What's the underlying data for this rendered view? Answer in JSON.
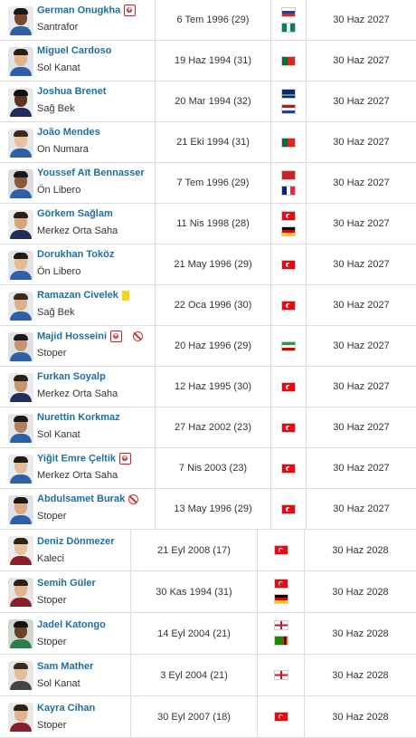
{
  "players": [
    {
      "name": "German Onugkha",
      "position": "Santrafor",
      "birth": "6 Tem 1996 (29)",
      "flags": [
        "russia",
        "nigeria"
      ],
      "contract": "30 Haz 2027",
      "badges": [
        "injury"
      ]
    },
    {
      "name": "Miguel Cardoso",
      "position": "Sol Kanat",
      "birth": "19 Haz 1994 (31)",
      "flags": [
        "portugal"
      ],
      "contract": "30 Haz 2027",
      "badges": []
    },
    {
      "name": "Joshua Brenet",
      "position": "Sağ Bek",
      "birth": "20 Mar 1994 (32)",
      "flags": [
        "curacao",
        "netherlands"
      ],
      "contract": "30 Haz 2027",
      "badges": []
    },
    {
      "name": "João Mendes",
      "position": "On Numara",
      "birth": "21 Eki 1994 (31)",
      "flags": [
        "portugal"
      ],
      "contract": "30 Haz 2027",
      "badges": []
    },
    {
      "name": "Youssef Aït Bennasser",
      "position": "Ön Libero",
      "birth": "7 Tem 1996 (29)",
      "flags": [
        "morocco",
        "france"
      ],
      "contract": "30 Haz 2027",
      "badges": []
    },
    {
      "name": "Görkem Sağlam",
      "position": "Merkez Orta Saha",
      "birth": "11 Nis 1998 (28)",
      "flags": [
        "turkey",
        "germany"
      ],
      "contract": "30 Haz 2027",
      "badges": []
    },
    {
      "name": "Dorukhan Toköz",
      "position": "Ön Libero",
      "birth": "21 May 1996 (29)",
      "flags": [
        "turkey"
      ],
      "contract": "30 Haz 2027",
      "badges": []
    },
    {
      "name": "Ramazan Civelek",
      "position": "Sağ Bek",
      "birth": "22 Oca 1996 (30)",
      "flags": [
        "turkey"
      ],
      "contract": "30 Haz 2027",
      "badges": [
        "yellow"
      ]
    },
    {
      "name": "Majid Hosseini",
      "position": "Stoper",
      "birth": "20 Haz 1996 (29)",
      "flags": [
        "iran"
      ],
      "contract": "30 Haz 2027",
      "badges": [
        "injury",
        "ban"
      ]
    },
    {
      "name": "Furkan Soyalp",
      "position": "Merkez Orta Saha",
      "birth": "12 Haz 1995 (30)",
      "flags": [
        "turkey"
      ],
      "contract": "30 Haz 2027",
      "badges": []
    },
    {
      "name": "Nurettin Korkmaz",
      "position": "Sol Kanat",
      "birth": "27 Haz 2002 (23)",
      "flags": [
        "turkey"
      ],
      "contract": "30 Haz 2027",
      "badges": []
    },
    {
      "name": "Yiğit Emre Çeltik",
      "position": "Merkez Orta Saha",
      "birth": "7 Nis 2003 (23)",
      "flags": [
        "turkey"
      ],
      "contract": "30 Haz 2027",
      "badges": [
        "injury"
      ]
    },
    {
      "name": "Abdulsamet Burak",
      "position": "Stoper",
      "birth": "13 May 1996 (29)",
      "flags": [
        "turkey"
      ],
      "contract": "30 Haz 2027",
      "badges": [
        "ban"
      ]
    },
    {
      "name": "Deniz Dönmezer",
      "position": "Kaleci",
      "birth": "21 Eyl 2008 (17)",
      "flags": [
        "turkey"
      ],
      "contract": "30 Haz 2028",
      "badges": []
    },
    {
      "name": "Semih Güler",
      "position": "Stoper",
      "birth": "30 Kas 1994 (31)",
      "flags": [
        "turkey",
        "germany"
      ],
      "contract": "30 Haz 2028",
      "badges": []
    },
    {
      "name": "Jadel Katongo",
      "position": "Stoper",
      "birth": "14 Eyl 2004 (21)",
      "flags": [
        "england",
        "zambia"
      ],
      "contract": "30 Haz 2028",
      "badges": []
    },
    {
      "name": "Sam Mather",
      "position": "Sol Kanat",
      "birth": "3 Eyl 2004 (21)",
      "flags": [
        "england"
      ],
      "contract": "30 Haz 2028",
      "badges": []
    },
    {
      "name": "Kayra Cihan",
      "position": "Stoper",
      "birth": "30 Eyl 2007 (18)",
      "flags": [
        "turkey"
      ],
      "contract": "30 Haz 2028",
      "badges": []
    }
  ],
  "colors": {
    "name_link": "#1d6f9e",
    "injury_red": "#c0272d",
    "yellow_card": "#f5d316",
    "border": "#dcdcdc"
  }
}
